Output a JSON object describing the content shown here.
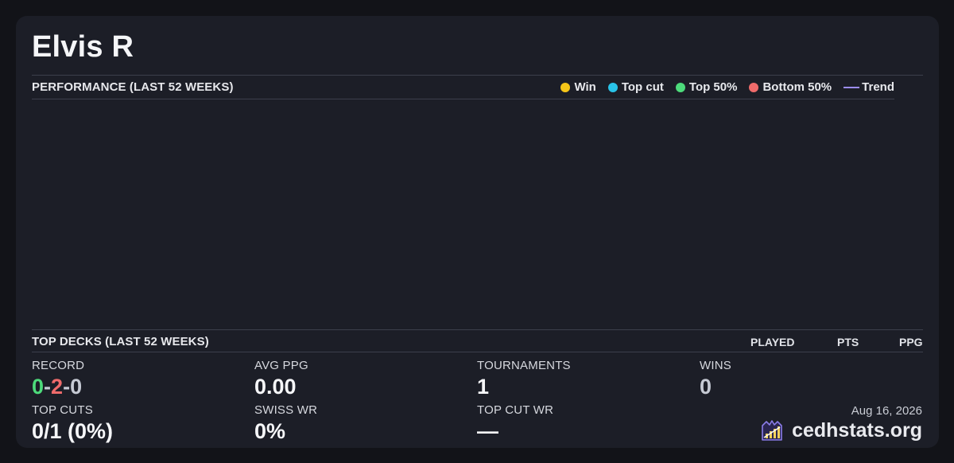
{
  "player": {
    "name": "Elvis R"
  },
  "performance": {
    "heading": "PERFORMANCE (LAST 52 WEEKS)",
    "legend": [
      {
        "label": "Win",
        "color": "#f5c518",
        "kind": "dot"
      },
      {
        "label": "Top cut",
        "color": "#29c3e8",
        "kind": "dot"
      },
      {
        "label": "Top 50%",
        "color": "#4ddb7b",
        "kind": "dot"
      },
      {
        "label": "Bottom 50%",
        "color": "#ef6b6b",
        "kind": "dot"
      },
      {
        "label": "Trend",
        "color": "#9b8cf0",
        "kind": "line"
      }
    ]
  },
  "top_decks": {
    "heading": "TOP DECKS (LAST 52 WEEKS)",
    "columns": {
      "played": "PLAYED",
      "pts": "PTS",
      "ppg": "PPG"
    }
  },
  "stats": {
    "record": {
      "label": "RECORD",
      "wins": "0",
      "losses": "2",
      "draws": "0",
      "sep": "-"
    },
    "avg_ppg": {
      "label": "AVG PPG",
      "value": "0.00"
    },
    "tournaments": {
      "label": "TOURNAMENTS",
      "value": "1"
    },
    "wins": {
      "label": "WINS",
      "value": "0"
    },
    "top_cuts": {
      "label": "TOP CUTS",
      "value": "0/1 (0%)"
    },
    "swiss_wr": {
      "label": "SWISS WR",
      "value": "0%"
    },
    "top_cut_wr": {
      "label": "TOP CUT WR",
      "value": "—"
    }
  },
  "footer": {
    "date": "Aug 16, 2026",
    "brand": "cedhstats.org",
    "logo_icon": "cedhstats-logo-icon"
  }
}
